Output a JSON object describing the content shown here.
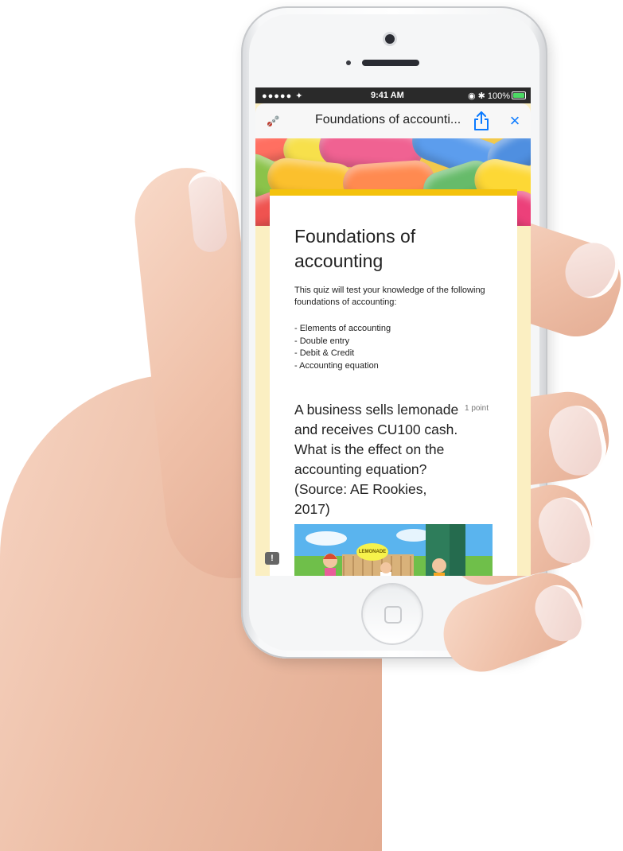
{
  "status_bar": {
    "signal": "●●●●● ✦",
    "time": "9:41 AM",
    "right_indicators": "◉ ✱ 100%",
    "battery_percent": 100
  },
  "nav_bar": {
    "logo": "logo-icon",
    "title": "Foundations of accounti...",
    "share": "share-icon",
    "close": "×"
  },
  "form": {
    "title": "Foundations of accounting",
    "description": "This quiz will test your knowledge of the following foundations of accounting:",
    "topics": [
      "- Elements of accounting",
      "- Double entry",
      "- Debit & Credit",
      "- Accounting equation"
    ]
  },
  "question": {
    "text": "A business sells lemonade and receives CU100 cash. What is the effect on the accounting equation? (Source: AE Rookies, 2017)",
    "points": "1 point",
    "image_sign": "LEMONADE"
  },
  "feedback": {
    "icon": "!"
  },
  "colors": {
    "accent": "#f4c20d",
    "page_background": "#fbefc2",
    "ios_blue": "#0a7aff"
  }
}
